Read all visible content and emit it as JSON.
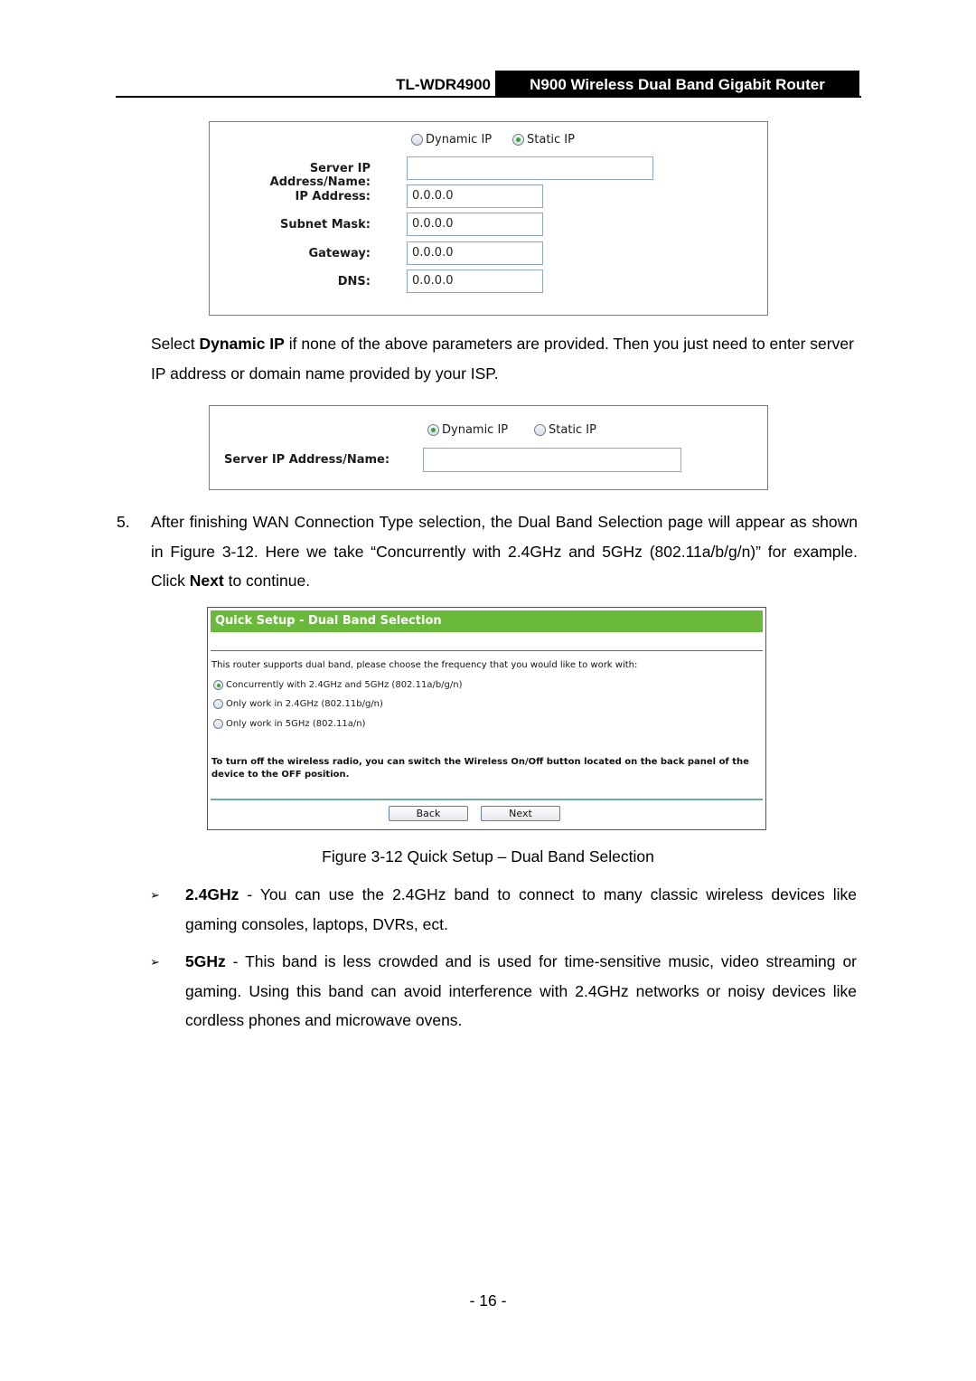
{
  "header": {
    "model": "TL-WDR4900",
    "title": "N900 Wireless Dual Band Gigabit Router"
  },
  "static_ip_panel": {
    "radio_options": [
      {
        "label": "Dynamic IP",
        "selected": false
      },
      {
        "label": "Static IP",
        "selected": true
      }
    ],
    "fields": [
      {
        "label": "Server IP Address/Name:",
        "value": ""
      },
      {
        "label": "IP Address:",
        "value": "0.0.0.0"
      },
      {
        "label": "Subnet Mask:",
        "value": "0.0.0.0"
      },
      {
        "label": "Gateway:",
        "value": "0.0.0.0"
      },
      {
        "label": "DNS:",
        "value": "0.0.0.0"
      }
    ]
  },
  "para_dynamic": {
    "pre": "Select ",
    "bold": "Dynamic IP",
    "post": " if none of the above parameters are provided. Then you just need to enter server IP address or domain name provided by your ISP."
  },
  "dynamic_ip_panel": {
    "radio_options": [
      {
        "label": "Dynamic IP",
        "selected": true
      },
      {
        "label": "Static IP",
        "selected": false
      }
    ],
    "fields": [
      {
        "label": "Server IP Address/Name:",
        "value": ""
      }
    ]
  },
  "step5": {
    "number": "5.",
    "pre": "After finishing WAN Connection Type selection, the Dual Band Selection page will appear as shown in Figure 3-12. Here we take “Concurrently with 2.4GHz and 5GHz (802.11a/b/g/n)” for example. Click ",
    "bold": "Next",
    "post": " to continue."
  },
  "dual_band_panel": {
    "title": "Quick Setup - Dual Band Selection",
    "intro": "This router supports dual band, please choose the frequency that you would like to work with:",
    "options": [
      {
        "label": "Concurrently with 2.4GHz and 5GHz (802.11a/b/g/n)",
        "selected": true
      },
      {
        "label": "Only work in 2.4GHz (802.11b/g/n)",
        "selected": false
      },
      {
        "label": "Only work in 5GHz (802.11a/n)",
        "selected": false
      }
    ],
    "note": "To turn off the wireless radio, you can switch the Wireless On/Off button located on the back panel of the device to the OFF position.",
    "back_label": "Back",
    "next_label": "Next",
    "header_color": "#6ab93b"
  },
  "figure_caption": "Figure 3-12 Quick Setup – Dual Band Selection",
  "bullets": [
    {
      "icon": "arrow-bullet-icon",
      "bold": "2.4GHz",
      "text": " - You can use the 2.4GHz band to connect to many classic wireless devices like gaming consoles, laptops, DVRs, ect."
    },
    {
      "icon": "arrow-bullet-icon",
      "bold": "5GHz",
      "text": " - This band is less crowded and is used for time-sensitive music, video streaming or gaming. Using this band can avoid interference with 2.4GHz networks or noisy devices like cordless phones and microwave ovens."
    }
  ],
  "bullet_glyph": "➢",
  "page_number": "- 16 -"
}
